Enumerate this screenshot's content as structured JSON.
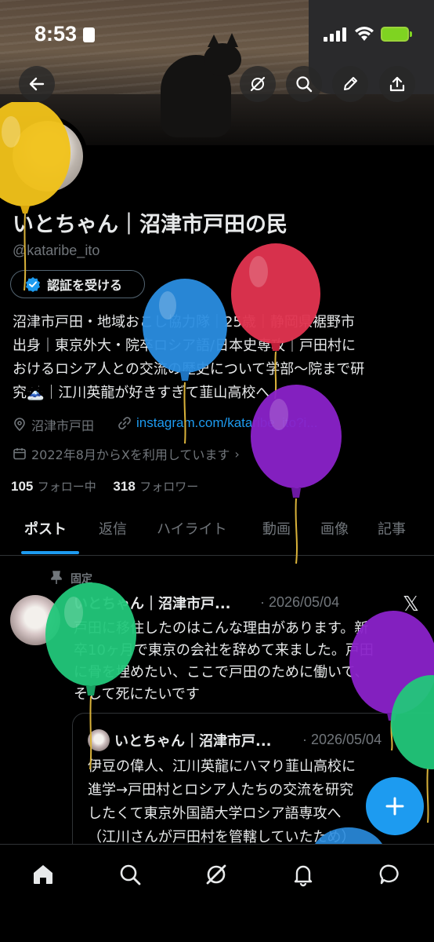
{
  "status_bar": {
    "time": "8:53"
  },
  "profile": {
    "display_name": "いとちゃん｜沼津市戸田の民",
    "handle": "@kataribe_ito",
    "verify_button": "認証を受ける",
    "bio_lines": [
      "沼津市戸田・地域おこし協力隊｜25歳｜静岡県裾野市",
      "出身｜東京外大・院卒ロシア語/日本史専攻｜戸田村に",
      "おけるロシア人との交流の歴史について学部〜院まで研",
      "究🗻｜江川英龍が好きすぎて韮山高校へ"
    ],
    "location": "沼津市戸田",
    "link": "instagram.com/kataribe_ito?i...",
    "joined": "2022年8月からXを利用しています",
    "following_count": "105",
    "following_label": "フォロー中",
    "followers_count": "318",
    "followers_label": "フォロワー"
  },
  "tabs": [
    "ポスト",
    "返信",
    "ハイライト",
    "動画",
    "画像",
    "記事"
  ],
  "pinned_post": {
    "pinned_label": "固定",
    "author": "いとちゃん｜沼津市戸...",
    "date": "· 2026/05/04",
    "text_lines": [
      "戸田に移住したのはこんな理由があります。新",
      "卒10ヶ月で東京の会社を辞めて来ました。戸田",
      "に骨を埋めたい、ここで戸田のために働いて、",
      "そして死にたいです"
    ],
    "quote": {
      "author": "いとちゃん｜沼津市戸...",
      "date": "· 2026/05/04",
      "text_lines": [
        "伊豆の偉人、江川英龍にハマり韮山高校に",
        "進学→戸田村とロシア人たちの交流を研究",
        "したくて東京外国語大学ロシア語専攻へ",
        "（江川さんが戸田村を管轄していたため）"
      ]
    }
  },
  "icons": {
    "back": "back-arrow-icon",
    "grok": "grok-icon",
    "search": "search-icon",
    "edit": "pencil-icon",
    "share": "share-icon",
    "home": "home-icon",
    "bell": "bell-icon",
    "messages": "messages-icon",
    "compose": "plus-icon"
  },
  "colors": {
    "accent": "#1d9bf0",
    "background": "#000000",
    "muted_text": "#71767b",
    "balloon_yellow": "#f0c21a",
    "balloon_red": "#e0334f",
    "balloon_blue": "#2a8de0",
    "balloon_purple": "#8a22c9",
    "balloon_green": "#22c77a"
  }
}
